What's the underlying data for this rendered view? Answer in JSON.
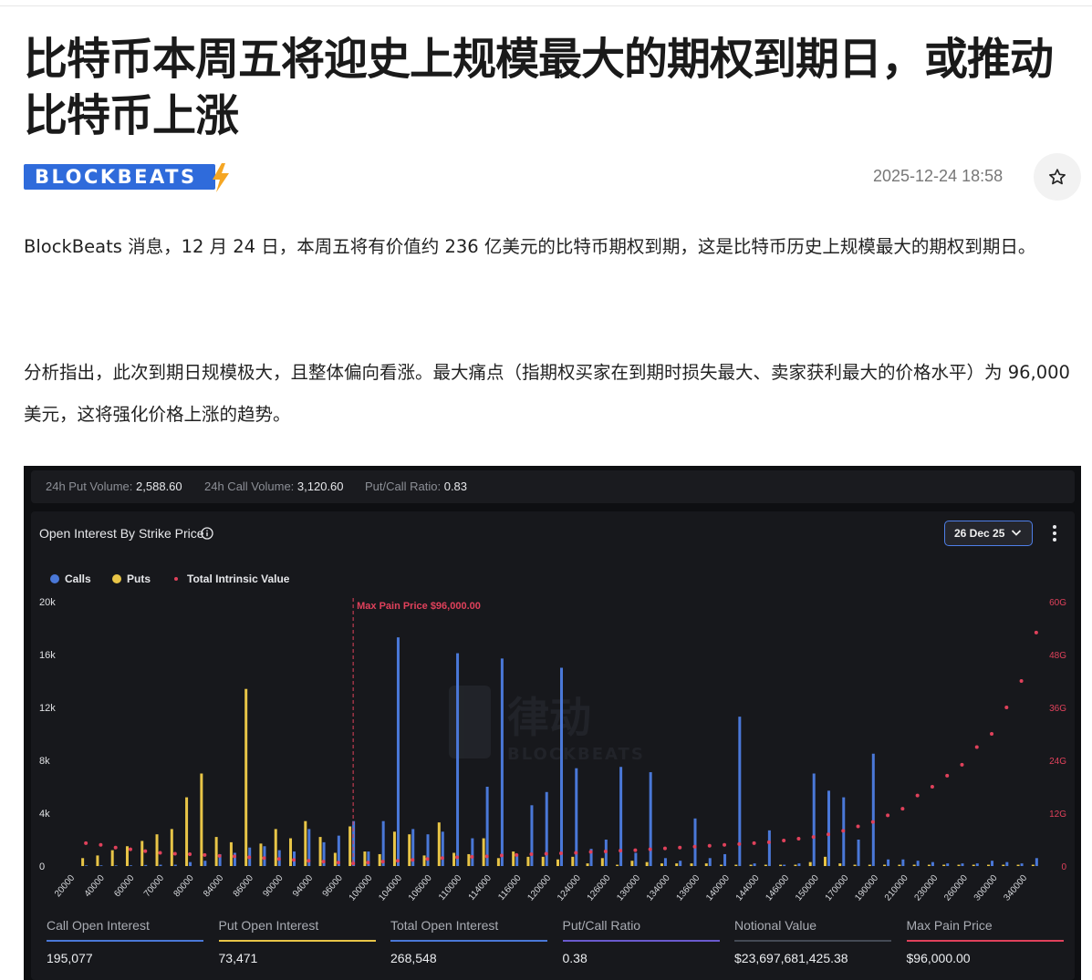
{
  "article": {
    "title": "比特币本周五将迎史上规模最大的期权到期日，或推动比特币上涨",
    "source_logo_text": "BLOCKBEATS",
    "date": "2025-12-24 18:58",
    "favorite_icon": "star-icon",
    "paragraphs": [
      "BlockBeats 消息，12 月 24 日，本周五将有价值约 236 亿美元的比特币期权到期，这是比特币历史上规模最大的期权到期日。",
      "分析指出，此次到期日规模极大，且整体偏向看涨。最大痛点（指期权买家在到期时损失最大、卖家获利最大的价格水平）为 96,000 美元，这将强化价格上涨的趋势。"
    ]
  },
  "screenshot": {
    "stats": [
      {
        "label": "24h Put Volume:",
        "value": "2,588.60"
      },
      {
        "label": "24h Call Volume:",
        "value": "3,120.60"
      },
      {
        "label": "Put/Call Ratio:",
        "value": "0.83"
      }
    ],
    "panel_title": "Open Interest By Strike Price",
    "info_icon": "info-icon",
    "date_selector": "26 Dec 25",
    "chevron_icon": "chevron-down-icon",
    "menu_icon": "kebab-menu-icon",
    "summary": [
      {
        "label": "Call Open Interest",
        "value": "195,077",
        "color": "#4a78d8"
      },
      {
        "label": "Put Open Interest",
        "value": "73,471",
        "color": "#e8c547"
      },
      {
        "label": "Total Open Interest",
        "value": "268,548",
        "color": "#4a78d8"
      },
      {
        "label": "Put/Call Ratio",
        "value": "0.38",
        "color": "#6a5acd"
      },
      {
        "label": "Notional Value",
        "value": "$23,697,681,425.38",
        "color": "#444a55"
      },
      {
        "label": "Max Pain Price",
        "value": "$96,000.00",
        "color": "#e0415b"
      }
    ]
  },
  "chart_data": {
    "type": "bar",
    "legend": [
      {
        "name": "Calls",
        "color": "#4a78d8"
      },
      {
        "name": "Puts",
        "color": "#e8c547"
      },
      {
        "name": "Total Intrinsic Value",
        "color": "#e0415b"
      }
    ],
    "legend_position": "top-left",
    "x_tick_labels": [
      "20000",
      "40000",
      "60000",
      "70000",
      "80000",
      "84000",
      "86000",
      "90000",
      "94000",
      "96000",
      "100000",
      "104000",
      "106000",
      "110000",
      "114000",
      "116000",
      "120000",
      "124000",
      "126000",
      "130000",
      "134000",
      "136000",
      "140000",
      "144000",
      "146000",
      "150000",
      "170000",
      "190000",
      "210000",
      "230000",
      "260000",
      "300000",
      "340000"
    ],
    "y_ticks_left": [
      "0",
      "4k",
      "8k",
      "12k",
      "16k",
      "20k"
    ],
    "y_ticks_right": [
      "0",
      "12G",
      "24G",
      "36G",
      "48G",
      "60G"
    ],
    "ylim_left": [
      0,
      20000
    ],
    "ylim_right": [
      0,
      60
    ],
    "y_right_unit": "G",
    "max_pain_annotation": "Max Pain Price $96,000.00",
    "max_pain_index": 18,
    "grid": false,
    "strikes": [
      "20000",
      "30000",
      "40000",
      "50000",
      "60000",
      "65000",
      "70000",
      "75000",
      "80000",
      "82000",
      "84000",
      "85000",
      "86000",
      "88000",
      "90000",
      "92000",
      "94000",
      "95000",
      "96000",
      "98000",
      "100000",
      "102000",
      "104000",
      "105000",
      "106000",
      "108000",
      "110000",
      "112000",
      "114000",
      "115000",
      "116000",
      "118000",
      "120000",
      "122000",
      "124000",
      "125000",
      "126000",
      "128000",
      "130000",
      "132000",
      "134000",
      "135000",
      "136000",
      "138000",
      "140000",
      "142000",
      "144000",
      "145000",
      "146000",
      "148000",
      "150000",
      "160000",
      "170000",
      "180000",
      "190000",
      "200000",
      "210000",
      "220000",
      "230000",
      "240000",
      "260000",
      "280000",
      "300000",
      "320000",
      "340000"
    ],
    "series": [
      {
        "name": "Calls",
        "values": [
          50,
          50,
          50,
          50,
          80,
          100,
          100,
          300,
          400,
          900,
          1000,
          1400,
          1500,
          1200,
          1100,
          2800,
          1800,
          2300,
          3400,
          1100,
          3400,
          17300,
          2800,
          2400,
          2600,
          16100,
          2100,
          6000,
          15700,
          900,
          4600,
          5600,
          15000,
          7400,
          1300,
          2000,
          7500,
          1000,
          7100,
          600,
          400,
          3600,
          600,
          900,
          11300,
          200,
          2700,
          100,
          200,
          7000,
          5700,
          5200,
          2000,
          8500,
          500,
          500,
          400,
          300,
          200,
          200,
          200,
          400,
          300,
          200,
          600
        ]
      },
      {
        "name": "Puts",
        "values": [
          600,
          800,
          1200,
          1500,
          1900,
          2400,
          2800,
          5200,
          7000,
          2200,
          1800,
          13400,
          1700,
          2800,
          2100,
          3400,
          2200,
          1000,
          3000,
          1100,
          900,
          2600,
          2400,
          800,
          3300,
          1000,
          900,
          2100,
          600,
          1100,
          700,
          700,
          500,
          700,
          200,
          600,
          100,
          400,
          300,
          200,
          200,
          200,
          200,
          100,
          100,
          100,
          100,
          100,
          100,
          300,
          700,
          200,
          100,
          100,
          100,
          100,
          100,
          100,
          100,
          100,
          100,
          100,
          100,
          100,
          100
        ]
      },
      {
        "name": "Total Intrinsic Value",
        "values": [
          5.2,
          4.8,
          4.2,
          3.8,
          3.4,
          3.0,
          2.8,
          2.7,
          2.5,
          2.3,
          2.2,
          2.0,
          1.8,
          1.6,
          1.4,
          1.2,
          1.0,
          0.8,
          0.6,
          0.8,
          1.0,
          1.2,
          1.4,
          1.6,
          1.8,
          2.0,
          2.1,
          2.2,
          2.4,
          2.5,
          2.7,
          2.8,
          2.9,
          3.0,
          3.2,
          3.3,
          3.5,
          3.6,
          3.8,
          4.0,
          4.2,
          4.4,
          4.6,
          4.8,
          5.0,
          5.2,
          5.4,
          5.8,
          6.2,
          6.6,
          7.2,
          8.0,
          9.0,
          10.0,
          11.5,
          13.0,
          16.0,
          18.0,
          20.5,
          23.0,
          27.0,
          30.0,
          36.0,
          42.0,
          53.0
        ]
      }
    ]
  }
}
